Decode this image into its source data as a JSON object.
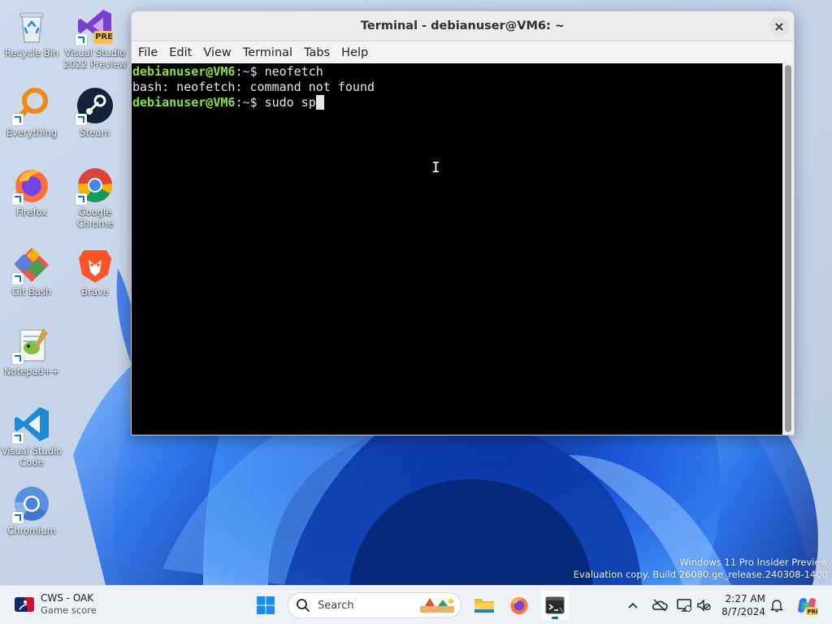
{
  "desktop": {
    "icons": [
      {
        "label": "Recycle Bin"
      },
      {
        "label": "Visual Studio 2022 Preview",
        "badge": "PRE"
      },
      {
        "label": "Everything"
      },
      {
        "label": "Steam"
      },
      {
        "label": "Firefox"
      },
      {
        "label": "Google Chrome"
      },
      {
        "label": "Git Bash"
      },
      {
        "label": "Brave"
      },
      {
        "label": "Notepad++"
      },
      {
        "label": "Visual Studio Code"
      },
      {
        "label": "Chromium"
      }
    ]
  },
  "terminal": {
    "title": "Terminal - debianuser@VM6: ~",
    "close_symbol": "×",
    "menu": [
      "File",
      "Edit",
      "View",
      "Terminal",
      "Tabs",
      "Help"
    ],
    "lines": [
      {
        "user": "debianuser@VM6",
        "sep": ":",
        "path": "~",
        "prompt": "$ ",
        "command": "neofetch"
      },
      {
        "output": "bash: neofetch: command not found"
      },
      {
        "user": "debianuser@VM6",
        "sep": ":",
        "path": "~",
        "prompt": "$ ",
        "command": "sudo sp"
      }
    ],
    "colors": {
      "user": "#8ae234",
      "path": "#729fcf",
      "background": "#000000",
      "text": "#e5e5e5"
    }
  },
  "watermark": {
    "line1": "Windows 11 Pro Insider Preview",
    "line2": "Evaluation copy. Build 26080.ge_release.240308-1400"
  },
  "taskbar": {
    "widget_title": "CWS - OAK",
    "widget_subtitle": "Game score",
    "search_placeholder": "Search",
    "pinned": [
      "start-icon",
      "file-explorer-icon",
      "firefox-icon",
      "terminal-icon"
    ],
    "clock_time": "2:27 AM",
    "clock_date": "8/7/2024",
    "accent": "#0067c0"
  }
}
